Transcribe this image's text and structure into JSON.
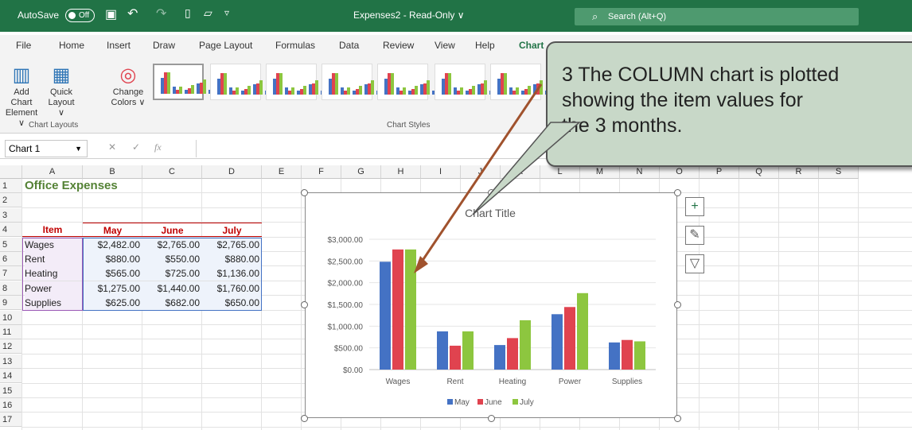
{
  "titlebar": {
    "autosave_label": "AutoSave",
    "autosave_state": "Off",
    "filename": "Expenses2  -  Read-Only ∨",
    "search_placeholder": "Search (Alt+Q)"
  },
  "tabs": [
    "File",
    "Home",
    "Insert",
    "Draw",
    "Page Layout",
    "Formulas",
    "Data",
    "Review",
    "View",
    "Help",
    "Chart"
  ],
  "ribbon": {
    "add_chart_element": [
      "Add Chart",
      "Element ∨"
    ],
    "quick_layout": [
      "Quick",
      "Layout ∨"
    ],
    "change_colors": [
      "Change",
      "Colors ∨"
    ],
    "group_layouts": "Chart Layouts",
    "group_styles": "Chart Styles"
  },
  "formula": {
    "name_box": "Chart 1",
    "fx": "fx"
  },
  "columns": [
    "A",
    "B",
    "C",
    "D",
    "E",
    "F",
    "G",
    "H",
    "I",
    "J",
    "K",
    "L",
    "M",
    "N",
    "O",
    "P",
    "Q",
    "R",
    "S"
  ],
  "rows": [
    "1",
    "2",
    "3",
    "4",
    "5",
    "6",
    "7",
    "8",
    "9",
    "10",
    "11",
    "12",
    "13",
    "14",
    "15",
    "16",
    "17"
  ],
  "sheet": {
    "title": "Office Expenses",
    "headers": [
      "Item",
      "May",
      "June",
      "July"
    ],
    "data": [
      [
        "Wages",
        "$2,482.00",
        "$2,765.00",
        "$2,765.00"
      ],
      [
        "Rent",
        "$880.00",
        "$550.00",
        "$880.00"
      ],
      [
        "Heating",
        "$565.00",
        "$725.00",
        "$1,136.00"
      ],
      [
        "Power",
        "$1,275.00",
        "$1,440.00",
        "$1,760.00"
      ],
      [
        "Supplies",
        "$625.00",
        "$682.00",
        "$650.00"
      ]
    ]
  },
  "callout": {
    "lines": [
      "3  The COLUMN chart is plotted",
      "showing the item values for",
      "the 3 months."
    ]
  },
  "chart_data": {
    "type": "bar",
    "title": "Chart Title",
    "categories": [
      "Wages",
      "Rent",
      "Heating",
      "Power",
      "Supplies"
    ],
    "series": [
      {
        "name": "May",
        "color": "#4472c4",
        "values": [
          2482,
          880,
          565,
          1275,
          625
        ]
      },
      {
        "name": "June",
        "color": "#e0434f",
        "values": [
          2765,
          550,
          725,
          1440,
          682
        ]
      },
      {
        "name": "July",
        "color": "#8dc63f",
        "values": [
          2765,
          880,
          1136,
          1760,
          650
        ]
      }
    ],
    "y_ticks": [
      "$3,000.00",
      "$2,500.00",
      "$2,000.00",
      "$1,500.00",
      "$1,000.00",
      "$500.00",
      "$0.00"
    ],
    "ylim": [
      0,
      3000
    ],
    "grid": true,
    "legend": "bottom"
  }
}
